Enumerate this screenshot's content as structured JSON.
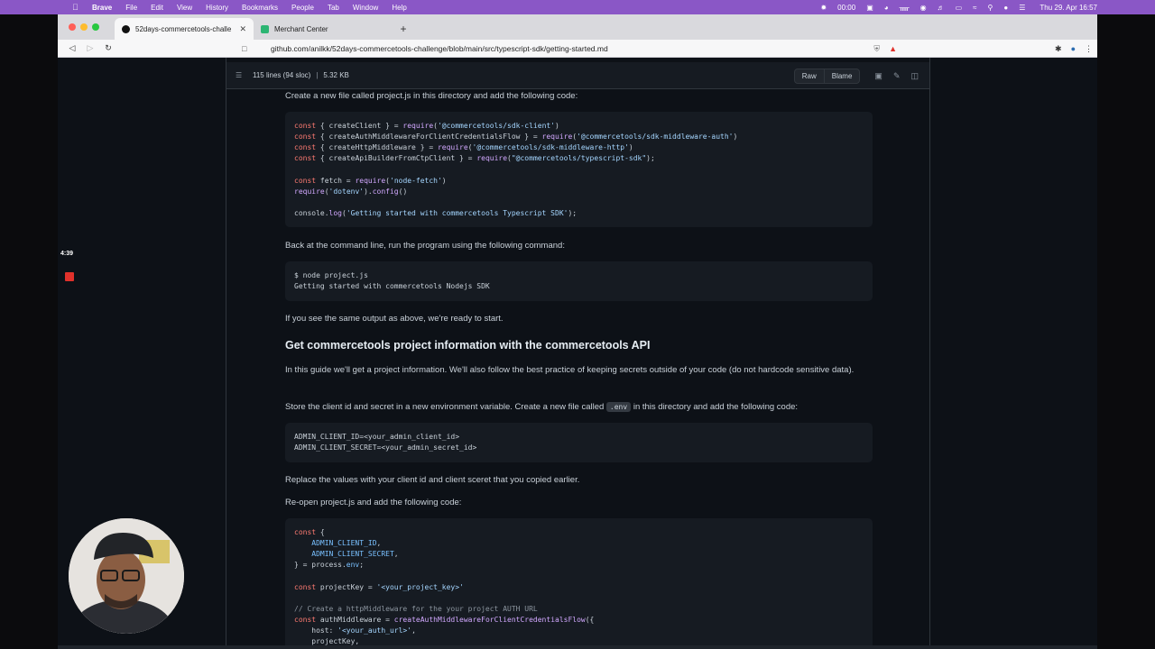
{
  "menubar": {
    "app": "Brave",
    "items": [
      "File",
      "Edit",
      "View",
      "History",
      "Bookmarks",
      "People",
      "Tab",
      "Window",
      "Help"
    ],
    "clock": "00:00",
    "datetime": "Thu 29. Apr  16:57"
  },
  "tabs": [
    {
      "title": "52days-commercetools-challe",
      "favicon": "github-icon",
      "active": true
    },
    {
      "title": "Merchant Center",
      "favicon": "commercetools-icon",
      "active": false
    }
  ],
  "address_bar": {
    "url": "github.com/anilkk/52days-commercetools-challenge/blob/main/src/typescript-sdk/getting-started.md"
  },
  "file_header": {
    "lines": "115 lines (94 sloc)",
    "size": "5.32 KB",
    "raw_label": "Raw",
    "blame_label": "Blame"
  },
  "article": {
    "p1": "Create a new file called project.js in this directory and add the following code:",
    "p2": "Back at the command line, run the program using the following command:",
    "p3": "If you see the same output as above, we're ready to start.",
    "h2": "Get commercetools project information with the commercetools API",
    "p4": "In this guide we'll get a project information. We'll also follow the best practice of keeping secrets outside of your code (do not hardcode sensitive data).",
    "p5_before": "Store the client id and secret in a new environment variable. Create a new file called ",
    "p5_code": ".env",
    "p5_after": " in this directory and add the following code:",
    "p6": "Replace the values with your client id and client sceret that you copied earlier.",
    "p7": "Re-open project.js and add the following code:"
  },
  "code1": [
    "const { createClient } = require('@commercetools/sdk-client')",
    "const { createAuthMiddlewareForClientCredentialsFlow } = require('@commercetools/sdk-middleware-auth')",
    "const { createHttpMiddleware } = require('@commercetools/sdk-middleware-http')",
    "const { createApiBuilderFromCtpClient } = require(\"@commercetools/typescript-sdk\");",
    "const fetch = require('node-fetch')",
    "require('dotenv').config()",
    "console.log('Getting started with commercetools Typescript SDK');"
  ],
  "code2": [
    "$ node project.js",
    "Getting started with commercetools Nodejs SDK"
  ],
  "code3": [
    "ADMIN_CLIENT_ID=<your_admin_client_id>",
    "ADMIN_CLIENT_SECRET=<your_admin_secret_id>"
  ],
  "code4": [
    "const {",
    "    ADMIN_CLIENT_ID,",
    "    ADMIN_CLIENT_SECRET,",
    "} = process.env;",
    "const projectKey = '<your_project_key>'",
    "// Create a httpMiddleware for the your project AUTH URL",
    "const authMiddleware = createAuthMiddlewareForClientCredentialsFlow({",
    "    host: '<your_auth_url>',",
    "    projectKey,"
  ],
  "recorder": {
    "timer": "4:39"
  },
  "colors": {
    "menubar": "#8a57c6",
    "page_bg": "#0d1117",
    "code_bg": "#161b22",
    "keyword": "#ff7b72",
    "function": "#d2a8ff",
    "string": "#a5d6ff",
    "variable": "#79c0ff",
    "comment": "#8b949e",
    "record": "#e0312b"
  }
}
